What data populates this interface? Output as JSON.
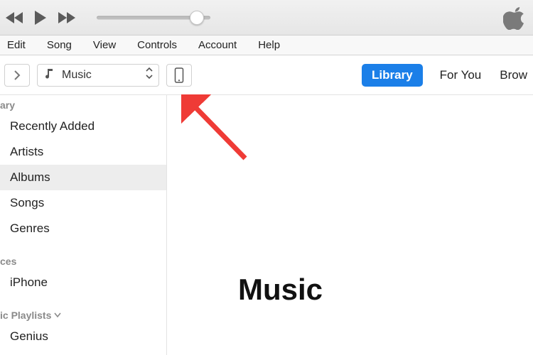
{
  "menus": [
    "Edit",
    "Song",
    "View",
    "Controls",
    "Account",
    "Help"
  ],
  "media_picker": {
    "label": "Music"
  },
  "nav_tabs": {
    "library": "Library",
    "for_you": "For You",
    "browse": "Brow"
  },
  "sidebar": {
    "library_head": "ary",
    "library_items": [
      "Recently Added",
      "Artists",
      "Albums",
      "Songs",
      "Genres"
    ],
    "library_selected_index": 2,
    "devices_head": "ces",
    "devices_items": [
      "iPhone"
    ],
    "playlists_head": "ic Playlists",
    "playlists_items": [
      "Genius"
    ]
  },
  "content": {
    "title": "Music"
  }
}
